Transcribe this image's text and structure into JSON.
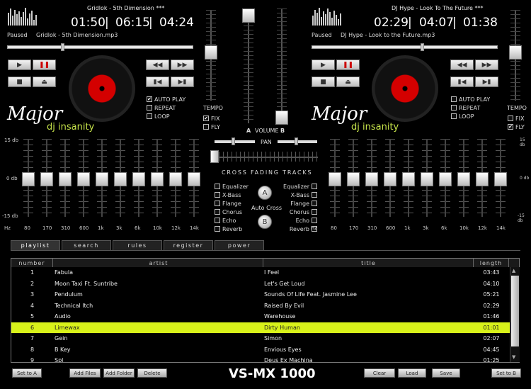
{
  "deck_a": {
    "title": "Gridlok - 5th Dimension ***",
    "time_elapsed": "01:50",
    "time_remaining": "06:15",
    "time_total": "04:24",
    "status": "Paused",
    "file": "Gridlok - 5th Dimension.mp3",
    "auto_play_label": "AUTO PLAY",
    "repeat_label": "REPEAT",
    "loop_label": "LOOP",
    "auto_play_checked": "✔",
    "tempo_label": "TEMPO",
    "fix_label": "FIX",
    "fly_label": "FLY",
    "fix_checked": "✔"
  },
  "deck_b": {
    "title": "DJ Hype - Look To The Future ***",
    "time_elapsed": "02:29",
    "time_remaining": "04:07",
    "time_total": "01:38",
    "status": "Paused",
    "file": "DJ Hype - Look to the Future.mp3",
    "auto_play_label": "AUTO PLAY",
    "repeat_label": "REPEAT",
    "loop_label": "LOOP",
    "tempo_label": "TEMPO",
    "fix_label": "FIX",
    "fly_label": "FLY",
    "fly_checked": "✔"
  },
  "logo": {
    "major": "Major",
    "sub": "dj insanity"
  },
  "mixer": {
    "volume_label": "VOLUME",
    "a_label": "A",
    "b_label": "B",
    "pan_label": "PAN",
    "cross_label": "CROSS FADING TRACKS",
    "auto_cross_label": "Auto Cross",
    "btn_a": "A",
    "btn_b": "B",
    "effects": [
      "Equalizer",
      "X-Bass",
      "Flange",
      "Chorus",
      "Echo",
      "Reverb"
    ]
  },
  "eq": {
    "db_top": "15 db",
    "db_mid": "0 db",
    "db_bot": "-15 db",
    "bands": [
      "Hz",
      "80",
      "170",
      "310",
      "600",
      "1k",
      "3k",
      "6k",
      "10k",
      "12k",
      "14k"
    ]
  },
  "tabs": [
    "playlist",
    "search",
    "rules",
    "register",
    "power"
  ],
  "playlist": {
    "headers": [
      "number",
      "artist",
      "title",
      "length"
    ],
    "rows": [
      {
        "n": "1",
        "artist": "Fabula",
        "title": "I Feel",
        "len": "03:43"
      },
      {
        "n": "2",
        "artist": "Moon Taxi Ft. Suntribe",
        "title": "Let's Get Loud",
        "len": "04:10"
      },
      {
        "n": "3",
        "artist": "Pendulum",
        "title": "Sounds Of Life Feat. Jasmine Lee",
        "len": "05:21"
      },
      {
        "n": "4",
        "artist": "Technical Itch",
        "title": "Raised By Evil",
        "len": "02:29"
      },
      {
        "n": "5",
        "artist": "Audio",
        "title": "Warehouse",
        "len": "01:46"
      },
      {
        "n": "6",
        "artist": "Limewax",
        "title": "Dirty Human",
        "len": "01:01"
      },
      {
        "n": "7",
        "artist": "Gein",
        "title": "Simon",
        "len": "02:07"
      },
      {
        "n": "8",
        "artist": "B Key",
        "title": "Envious Eyes",
        "len": "04:45"
      },
      {
        "n": "9",
        "artist": "Spl",
        "title": "Deus Ex Machina",
        "len": "01:25"
      }
    ]
  },
  "bottom": {
    "set_a": "Set to A",
    "add_files": "Add Files",
    "add_folder": "Add Folder",
    "delete": "Delete",
    "brand": "VS-MX 1000",
    "clear": "Clear",
    "load": "Load",
    "save": "Save",
    "set_b": "Set to B"
  },
  "colors": {
    "selected_row": "#d8f21a",
    "vinyl_label": "#d40000",
    "logo_sub": "#c6e34a"
  }
}
